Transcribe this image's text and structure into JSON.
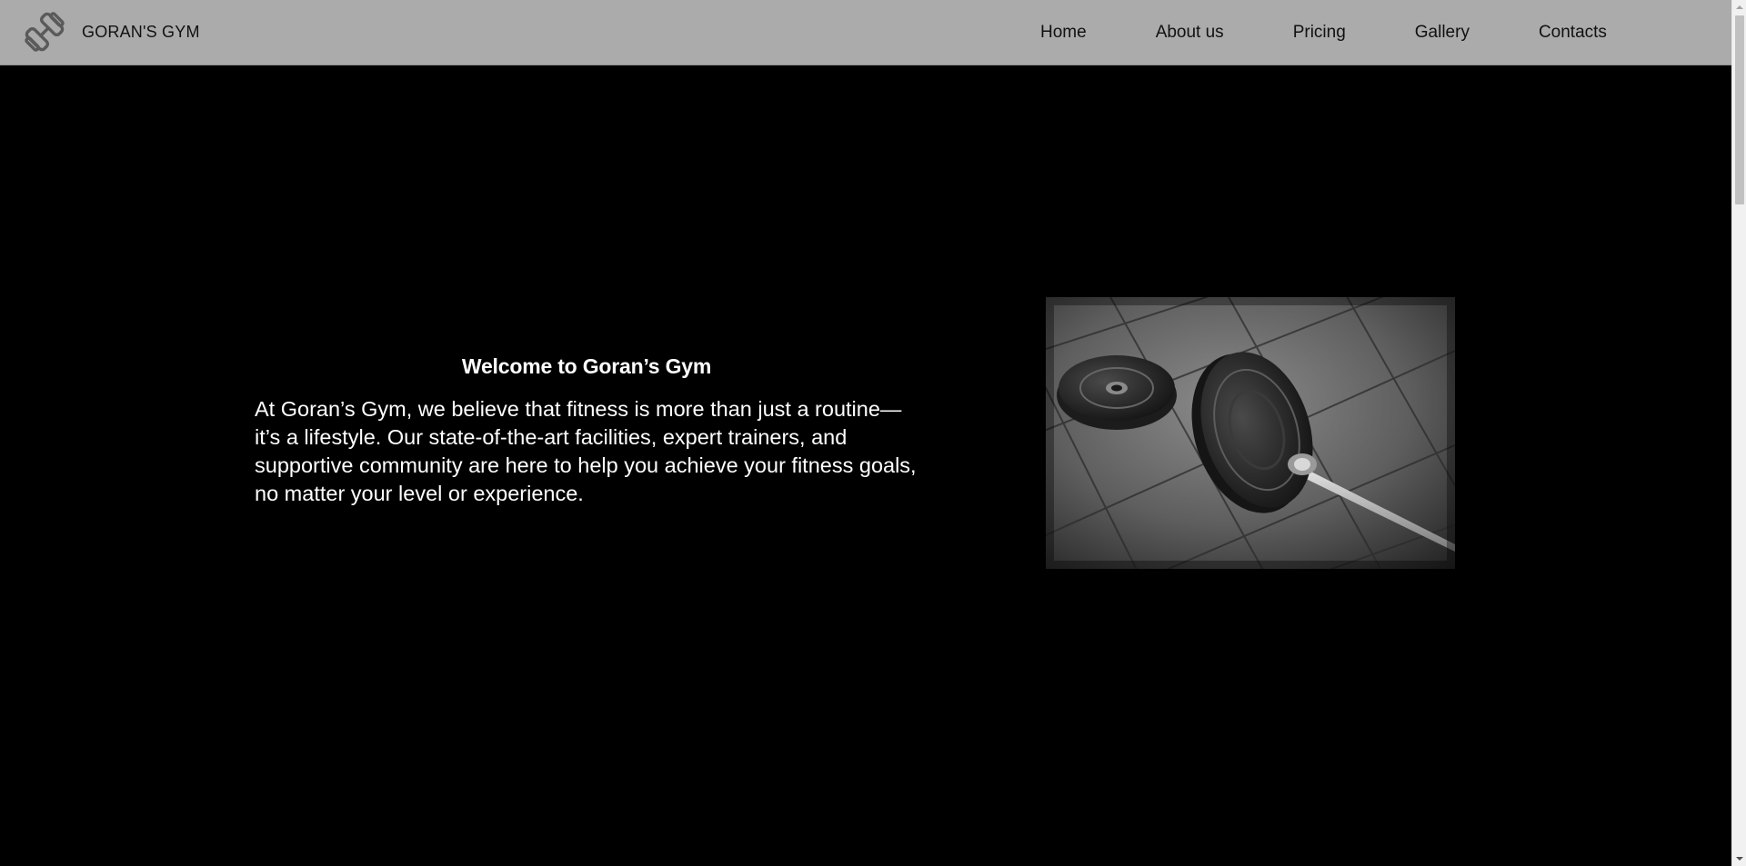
{
  "header": {
    "logo_icon": "dumbbell-logo-icon",
    "brand_name": "GORAN'S GYM",
    "nav": [
      {
        "label": "Home"
      },
      {
        "label": "About us"
      },
      {
        "label": "Pricing"
      },
      {
        "label": "Gallery"
      },
      {
        "label": "Contacts"
      }
    ]
  },
  "hero": {
    "title": "Welcome to Goran’s Gym",
    "body": "At Goran’s Gym, we believe that fitness is more than just a routine—it’s a lifestyle. Our state-of-the-art facilities, expert trainers, and supportive community are here to help you achieve your fitness goals, no matter your level or experience.",
    "image": "barbell-on-gym-floor-photo"
  },
  "colors": {
    "header_bg": "#ababab",
    "page_bg": "#000000",
    "text_light": "#ffffff",
    "text_dark": "#111111"
  }
}
